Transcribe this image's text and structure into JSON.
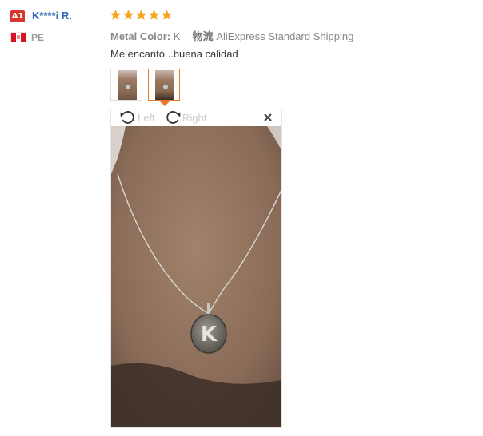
{
  "reviewer": {
    "level_badge": "A1",
    "name": "K****i R.",
    "country": "PE"
  },
  "rating": {
    "stars": 5,
    "max": 5,
    "star_color": "#f5a623"
  },
  "product": {
    "color_label": "Metal Color:",
    "color_value": "K",
    "shipping_label": "物流",
    "shipping_value": "AliExpress Standard Shipping"
  },
  "review_text": "Me encantó...buena calidad",
  "viewer": {
    "rotate_left_label": "Left",
    "rotate_right_label": "Right",
    "pendant_letter": "K"
  },
  "colors": {
    "accent": "#e7772d",
    "link": "#2b66b8",
    "badge": "#d9362b"
  }
}
